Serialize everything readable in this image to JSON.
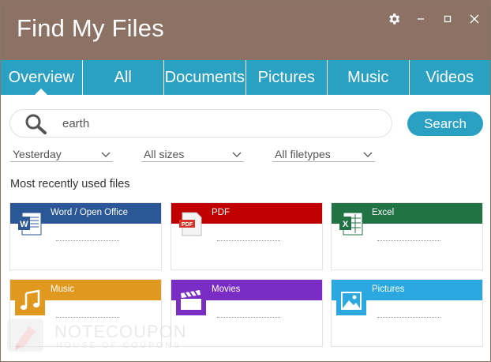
{
  "window": {
    "title": "Find My Files"
  },
  "controls": {
    "settings": "settings-gear-icon",
    "minimize": "minimize-icon",
    "maximize": "maximize-icon",
    "close": "close-icon"
  },
  "tabs": [
    {
      "label": "Overview",
      "active": true
    },
    {
      "label": "All"
    },
    {
      "label": "Documents"
    },
    {
      "label": "Pictures"
    },
    {
      "label": "Music"
    },
    {
      "label": "Videos"
    }
  ],
  "search": {
    "value": "earth",
    "button_label": "Search"
  },
  "filters": {
    "date": "Yesterday",
    "size": "All sizes",
    "filetype": "All filetypes"
  },
  "recent": {
    "title": "Most recently used files",
    "cards": [
      {
        "label": "Word / Open Office",
        "color": "#2b5797",
        "icon": "word-doc-icon"
      },
      {
        "label": "PDF",
        "color": "#c00000",
        "icon": "pdf-doc-icon"
      },
      {
        "label": "Excel",
        "color": "#217346",
        "icon": "excel-doc-icon"
      },
      {
        "label": "Music",
        "color": "#e0981e",
        "icon": "music-note-icon"
      },
      {
        "label": "Movies",
        "color": "#7a2dc4",
        "icon": "clapperboard-icon"
      },
      {
        "label": "Pictures",
        "color": "#2aa8df",
        "icon": "picture-icon"
      }
    ]
  },
  "watermark": {
    "title": "NOTECOUPON",
    "subtitle": "HOUSE OF COUPONS"
  },
  "colors": {
    "titlebar": "#8b7264",
    "accent": "#2aa0c2"
  }
}
